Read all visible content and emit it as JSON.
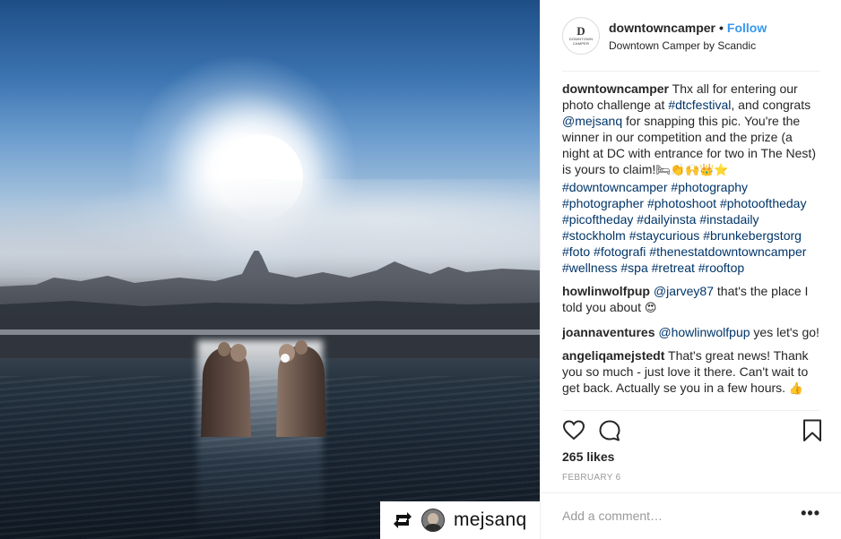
{
  "post": {
    "reposted_from": "mejsanq"
  },
  "header": {
    "logo_mark": "D",
    "logo_text": "DOWNTOWN CAMPER",
    "username": "downtowncamper",
    "separator": "•",
    "follow_label": "Follow",
    "location": "Downtown Camper by Scandic"
  },
  "caption": {
    "user": "downtowncamper",
    "text_1": " Thx all for entering our photo challenge at ",
    "tag_dtcfestival": "#dtcfestival",
    "text_2": ", and congrats ",
    "mention_mejsanq": "@mejsanq",
    "text_3": " for snapping this pic. You're the winner in our competition and the prize (a night at DC with entrance for two in The Nest) is yours to claim!",
    "emojis": "🛏👏🙌👑⭐",
    "hashtags": [
      "#downtowncamper",
      "#photography",
      "#photographer",
      "#photoshoot",
      "#photooftheday",
      "#picoftheday",
      "#dailyinsta",
      "#instadaily",
      "#stockholm",
      "#staycurious",
      "#brunkebergstorg",
      "#foto",
      "#fotografi",
      "#thenestatdowntowncamper",
      "#wellness",
      "#spa",
      "#retreat",
      "#rooftop"
    ]
  },
  "comments": [
    {
      "user": "howlinwolfpup",
      "mention": "@jarvey87",
      "text": " that's the place I told you about ",
      "emoji": "😍"
    },
    {
      "user": "joannaventures",
      "mention": "@howlinwolfpup",
      "text": " yes let's go!",
      "emoji": ""
    },
    {
      "user": "angeliqamejstedt",
      "mention": "",
      "text": " That's great news! Thank you so much - just love it there. Can't wait to get back. Actually se you in a few hours. ",
      "emoji": "👍"
    }
  ],
  "actions": {
    "like_icon": "heart-icon",
    "comment_icon": "comment-icon",
    "save_icon": "bookmark-icon"
  },
  "likes": "265 likes",
  "date": "FEBRUARY 6",
  "add_comment": {
    "placeholder": "Add a comment…",
    "more_label": "•••"
  },
  "colors": {
    "link": "#003569",
    "follow": "#3897f0",
    "muted": "#999999"
  }
}
